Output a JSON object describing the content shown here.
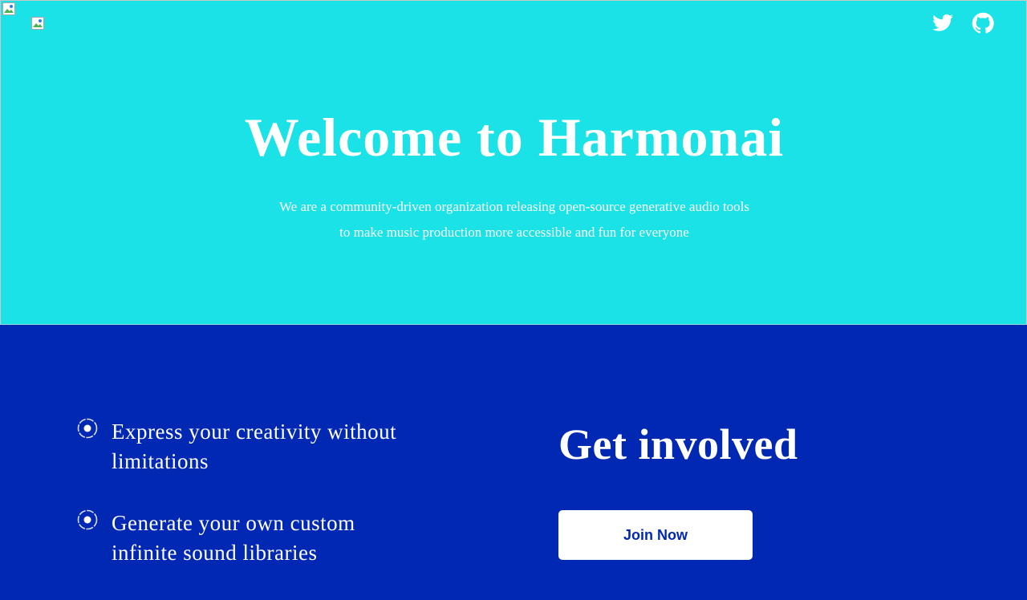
{
  "hero": {
    "title": "Welcome to Harmonai",
    "subtitle": "We are a community-driven  organization releasing open-source generative audio tools to make music production more accessible and fun for everyone",
    "background_color": "#1BE2E6"
  },
  "header": {
    "logo_icon": "broken-image-icon",
    "social": [
      {
        "icon": "twitter-icon"
      },
      {
        "icon": "github-icon"
      }
    ]
  },
  "features": {
    "icon": "radio-target-icon",
    "items": [
      {
        "text": "Express your creativity without limitations"
      },
      {
        "text": "Generate your own custom infinite sound libraries"
      }
    ]
  },
  "get_involved": {
    "title": "Get involved",
    "button_label": "Join Now"
  },
  "colors": {
    "accent_dark": "#0028B3",
    "accent_light": "#1BE2E6",
    "text": "#FFFFFF"
  }
}
